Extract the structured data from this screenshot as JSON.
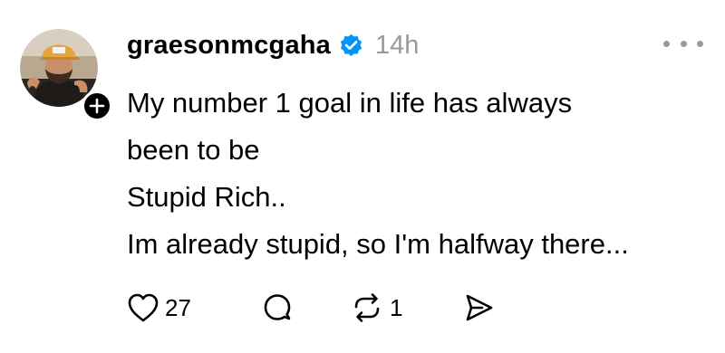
{
  "post": {
    "username": "graesonmcgaha",
    "time": "14h",
    "verified_icon": "verified-badge-icon",
    "verified_color": "#0095f6",
    "text_lines": [
      "My number 1 goal in life has always",
      "been to be",
      "Stupid Rich..",
      "Im already stupid, so I'm halfway there..."
    ],
    "likes": "27",
    "reposts": "1",
    "icons": {
      "follow": "plus-icon",
      "more": "more-options-icon",
      "like": "heart-icon",
      "comment": "comment-icon",
      "repost": "repost-icon",
      "share": "send-icon"
    }
  }
}
